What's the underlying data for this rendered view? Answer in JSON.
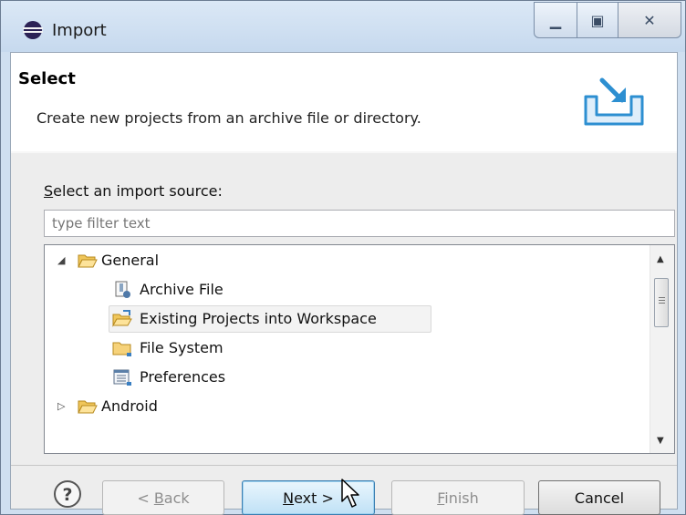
{
  "window": {
    "title": "Import"
  },
  "banner": {
    "title": "Select",
    "description": "Create new projects from an archive file or directory."
  },
  "source": {
    "label_accel": "S",
    "label_rest": "elect an import source:",
    "filter_placeholder": "type filter text"
  },
  "tree": {
    "items": [
      {
        "label": "General",
        "expanded": true,
        "icon": "folder-open-icon"
      },
      {
        "label": "Archive File",
        "icon": "archive-file-icon"
      },
      {
        "label": "Existing Projects into Workspace",
        "icon": "projects-folder-icon",
        "selected": true
      },
      {
        "label": "File System",
        "icon": "folder-icon"
      },
      {
        "label": "Preferences",
        "icon": "preferences-icon"
      },
      {
        "label": "Android",
        "expanded": false,
        "icon": "folder-open-icon"
      }
    ]
  },
  "buttons": {
    "back_pre": "< ",
    "back_accel": "B",
    "back_rest": "ack",
    "next_accel": "N",
    "next_rest": "ext >",
    "finish_accel": "F",
    "finish_rest": "inish",
    "cancel": "Cancel"
  },
  "colors": {
    "title_bar": "#cfdff0",
    "default_button": "#bfe1f6",
    "selection": "#f3f3f3"
  }
}
